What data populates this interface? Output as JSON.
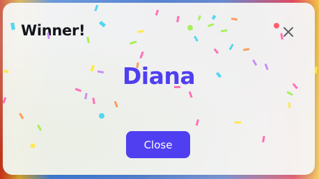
{
  "dialog": {
    "title": "Winner!",
    "winner_name": "Diana",
    "close_button_label": "Close",
    "close_icon": "close-icon"
  },
  "colors": {
    "accent": "#4f3ff0",
    "title_text": "#15161c",
    "button_text": "#ffffff",
    "dialog_background": "#f6f6f4",
    "confetti": [
      "#ff6fb5",
      "#a6f05a",
      "#ffe94a",
      "#4fd7f2",
      "#c98df5",
      "#ff9b5a",
      "#ff5f6d"
    ]
  }
}
